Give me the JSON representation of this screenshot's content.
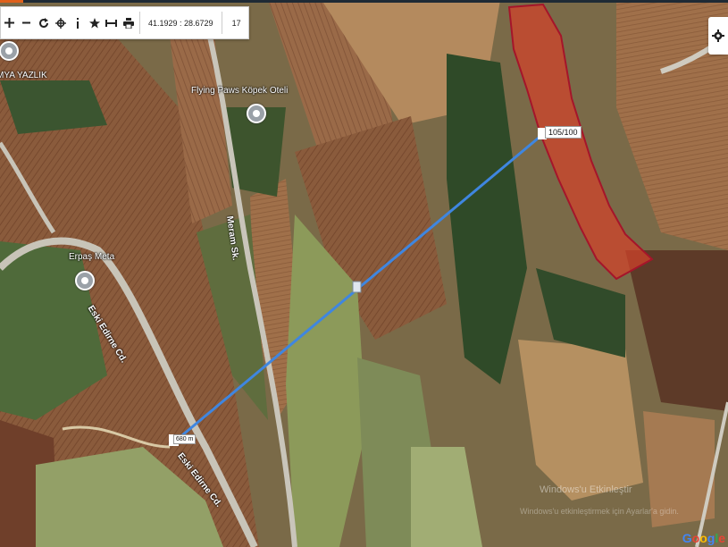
{
  "toolbar": {
    "tools": [
      {
        "name": "zoom-in-icon"
      },
      {
        "name": "zoom-out-icon"
      },
      {
        "name": "refresh-icon"
      },
      {
        "name": "locate-icon"
      },
      {
        "name": "info-icon"
      },
      {
        "name": "star-icon"
      },
      {
        "name": "measure-icon"
      },
      {
        "name": "print-icon"
      }
    ],
    "coordinates": "41.1929 : 28.6729",
    "zoom_level": "17"
  },
  "places": {
    "yazlik": "MYA YAZLIK",
    "hotel": "Flying Paws Köpek Oteli",
    "erpas": "Erpaş Meta"
  },
  "streets": {
    "meram": "Meram Sk.",
    "edirne_upper": "Eski Edirne Cd.",
    "edirne_lower": "Eski Edirne Cd."
  },
  "measure": {
    "parcel_label": "105/100",
    "distance_label": "680 m"
  },
  "watermark": {
    "line1": "Windows'u Etkinleştir",
    "line2": "Windows'u etkinleştirmek için Ayarlar'a gidin."
  },
  "attribution": {
    "google": "Google"
  },
  "colors": {
    "parcel_fill": "#d2432a",
    "parcel_stroke": "#a5152a",
    "measure_line": "#3f86e0",
    "topbar": "#1f2a35"
  }
}
